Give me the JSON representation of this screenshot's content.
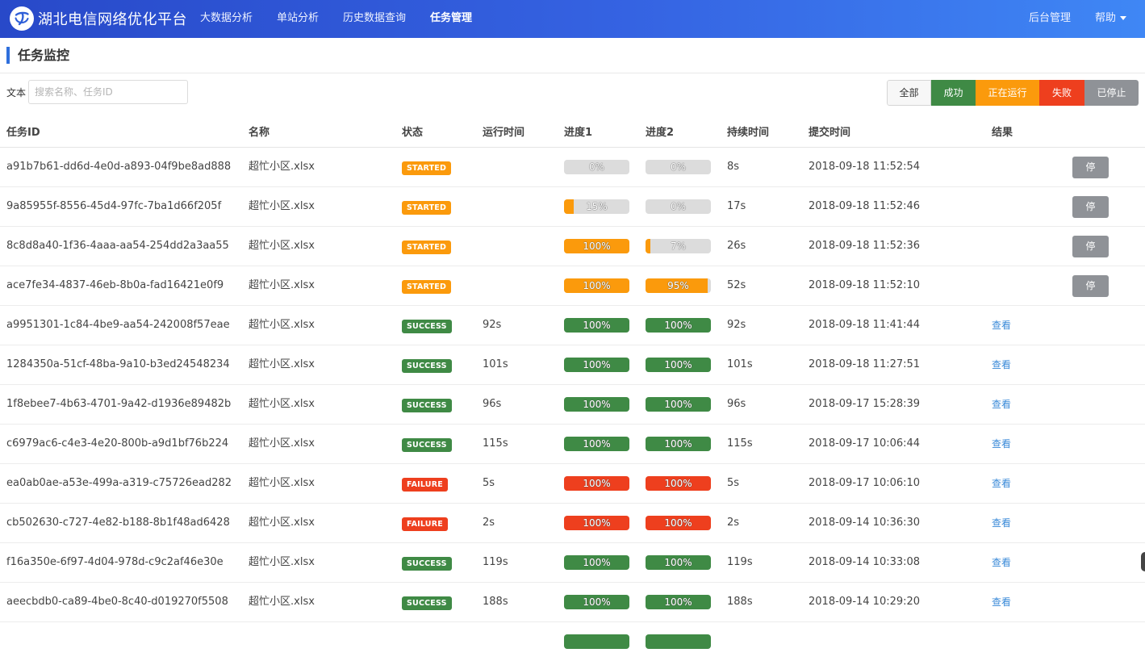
{
  "app": {
    "title": "湖北电信网络优化平台",
    "nav": [
      {
        "label": "大数据分析",
        "active": false
      },
      {
        "label": "单站分析",
        "active": false
      },
      {
        "label": "历史数据查询",
        "active": false
      },
      {
        "label": "任务管理",
        "active": true
      }
    ],
    "nav_right": [
      "后台管理",
      "帮助"
    ]
  },
  "page": {
    "title": "任务监控",
    "filter_label": "文本",
    "search_placeholder": "搜索名称、任务ID",
    "search_value": "",
    "filters": [
      {
        "key": "all",
        "label": "全部"
      },
      {
        "key": "success",
        "label": "成功"
      },
      {
        "key": "running",
        "label": "正在运行"
      },
      {
        "key": "failure",
        "label": "失败"
      },
      {
        "key": "stopped",
        "label": "已停止"
      }
    ]
  },
  "colors": {
    "started": "#fb9a0c",
    "success": "#3f8a45",
    "failure": "#ee3f1e",
    "stopped": "#8f9297",
    "link": "#3a8ad8"
  },
  "table": {
    "columns": [
      "任务ID",
      "名称",
      "状态",
      "运行时间",
      "进度1",
      "进度2",
      "持续时间",
      "提交时间",
      "结果"
    ],
    "stop_label": "停",
    "view_label": "查看",
    "rows": [
      {
        "id": "a91b7b61-dd6d-4e0d-a893-04f9be8ad888",
        "name": "超忙小区.xlsx",
        "status": "STARTED",
        "run_time": "",
        "p1": 0,
        "p1_text": "0%",
        "p2": 0,
        "p2_text": "0%",
        "duration": "8s",
        "submitted": "2018-09-18 11:52:54"
      },
      {
        "id": "9a85955f-8556-45d4-97fc-7ba1d66f205f",
        "name": "超忙小区.xlsx",
        "status": "STARTED",
        "run_time": "",
        "p1": 15,
        "p1_text": "15%",
        "p2": 0,
        "p2_text": "0%",
        "duration": "17s",
        "submitted": "2018-09-18 11:52:46"
      },
      {
        "id": "8c8d8a40-1f36-4aaa-aa54-254dd2a3aa55",
        "name": "超忙小区.xlsx",
        "status": "STARTED",
        "run_time": "",
        "p1": 100,
        "p1_text": "100%",
        "p2": 7,
        "p2_text": "7%",
        "duration": "26s",
        "submitted": "2018-09-18 11:52:36"
      },
      {
        "id": "ace7fe34-4837-46eb-8b0a-fad16421e0f9",
        "name": "超忙小区.xlsx",
        "status": "STARTED",
        "run_time": "",
        "p1": 100,
        "p1_text": "100%",
        "p2": 95,
        "p2_text": "95%",
        "duration": "52s",
        "submitted": "2018-09-18 11:52:10"
      },
      {
        "id": "a9951301-1c84-4be9-aa54-242008f57eae",
        "name": "超忙小区.xlsx",
        "status": "SUCCESS",
        "run_time": "92s",
        "p1": 100,
        "p1_text": "100%",
        "p2": 100,
        "p2_text": "100%",
        "duration": "92s",
        "submitted": "2018-09-18 11:41:44"
      },
      {
        "id": "1284350a-51cf-48ba-9a10-b3ed24548234",
        "name": "超忙小区.xlsx",
        "status": "SUCCESS",
        "run_time": "101s",
        "p1": 100,
        "p1_text": "100%",
        "p2": 100,
        "p2_text": "100%",
        "duration": "101s",
        "submitted": "2018-09-18 11:27:51"
      },
      {
        "id": "1f8ebee7-4b63-4701-9a42-d1936e89482b",
        "name": "超忙小区.xlsx",
        "status": "SUCCESS",
        "run_time": "96s",
        "p1": 100,
        "p1_text": "100%",
        "p2": 100,
        "p2_text": "100%",
        "duration": "96s",
        "submitted": "2018-09-17 15:28:39"
      },
      {
        "id": "c6979ac6-c4e3-4e20-800b-a9d1bf76b224",
        "name": "超忙小区.xlsx",
        "status": "SUCCESS",
        "run_time": "115s",
        "p1": 100,
        "p1_text": "100%",
        "p2": 100,
        "p2_text": "100%",
        "duration": "115s",
        "submitted": "2018-09-17 10:06:44"
      },
      {
        "id": "ea0ab0ae-a53e-499a-a319-c75726ead282",
        "name": "超忙小区.xlsx",
        "status": "FAILURE",
        "run_time": "5s",
        "p1": 100,
        "p1_text": "100%",
        "p2": 100,
        "p2_text": "100%",
        "duration": "5s",
        "submitted": "2018-09-17 10:06:10"
      },
      {
        "id": "cb502630-c727-4e82-b188-8b1f48ad6428",
        "name": "超忙小区.xlsx",
        "status": "FAILURE",
        "run_time": "2s",
        "p1": 100,
        "p1_text": "100%",
        "p2": 100,
        "p2_text": "100%",
        "duration": "2s",
        "submitted": "2018-09-14 10:36:30"
      },
      {
        "id": "f16a350e-6f97-4d04-978d-c9c2af46e30e",
        "name": "超忙小区.xlsx",
        "status": "SUCCESS",
        "run_time": "119s",
        "p1": 100,
        "p1_text": "100%",
        "p2": 100,
        "p2_text": "100%",
        "duration": "119s",
        "submitted": "2018-09-14 10:33:08"
      },
      {
        "id": "aeecbdb0-ca89-4be0-8c40-d019270f5508",
        "name": "超忙小区.xlsx",
        "status": "SUCCESS",
        "run_time": "188s",
        "p1": 100,
        "p1_text": "100%",
        "p2": 100,
        "p2_text": "100%",
        "duration": "188s",
        "submitted": "2018-09-14 10:29:20"
      }
    ]
  }
}
